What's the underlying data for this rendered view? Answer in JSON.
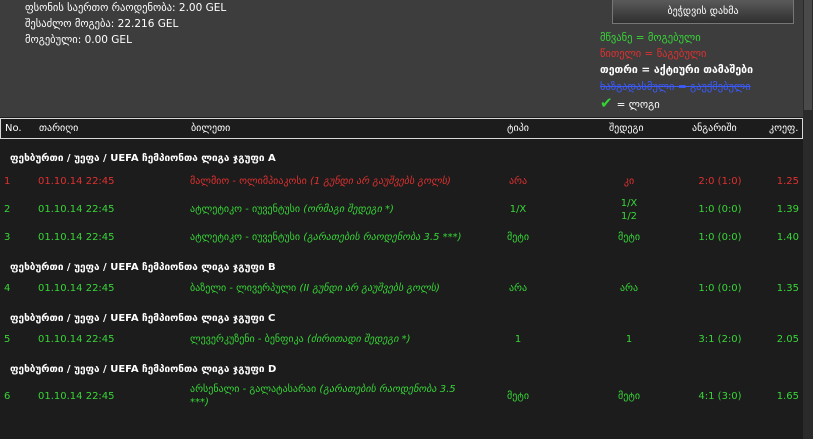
{
  "summary": {
    "total_stake": "ფსონის საერთო რაოდენობა: 2.00 GEL",
    "potential_win": "შესაძლო მოგება: 22.216 GEL",
    "won": "მოგებული: 0.00 GEL"
  },
  "print_button": "ბეჭდვის დახმა",
  "legend": {
    "won": "მწვანე = მოგებული",
    "lost": "წითელი = წაგებული",
    "active": "თეთრი = აქტიური თამაშები",
    "unset": "ხაზგადასმული = გაუქმებული",
    "stake": "= ლოგი"
  },
  "columns": {
    "no": "No.",
    "date": "თარიღი",
    "event": "ბილეთი",
    "type": "ტიპი",
    "prediction": "შედეგი",
    "result": "ანგარიში",
    "odds": "კოეფ."
  },
  "groups": [
    {
      "title": "ფეხბურთი / უეფა / UEFA ჩემპიონთა ლიგა ჯგუფი A"
    },
    {
      "title": "ფეხბურთი / უეფა / UEFA ჩემპიონთა ლიგა ჯგუფი B"
    },
    {
      "title": "ფეხბურთი / უეფა / UEFA ჩემპიონთა ლიგა ჯგუფი C"
    },
    {
      "title": "ფეხბურთი / უეფა / UEFA ჩემპიონთა ლიგა ჯგუფი D"
    }
  ],
  "rows": [
    {
      "no": "1",
      "date": "01.10.14 22:45",
      "event": "მალმიო - ოლიმპიაკოსი",
      "note": "(1 გუნდი არ გაუშვებს გოლს)",
      "type": "არა",
      "prediction": "კი",
      "result": "2:0 (1:0)",
      "odds": "1.25",
      "status": "lost"
    },
    {
      "no": "2",
      "date": "01.10.14 22:45",
      "event": "ატლეტიკო - იუვენტუსი",
      "note": "(ორმაგი შედეგი *)",
      "type": "1/X",
      "prediction_line1": "1/X",
      "prediction_line2": "1/2",
      "result": "1:0 (0:0)",
      "odds": "1.39",
      "status": "won"
    },
    {
      "no": "3",
      "date": "01.10.14 22:45",
      "event": "ატლეტიკო - იუვენტუსი",
      "note": "(გარათების რაოდენობა 3.5 ***)",
      "type": "მეტი",
      "prediction": "მეტი",
      "result": "1:0 (0:0)",
      "odds": "1.40",
      "status": "won"
    },
    {
      "no": "4",
      "date": "01.10.14 22:45",
      "event": "ბაზელი - ლივერპული",
      "note": "(II გუნდი არ გაუშვებს გოლს)",
      "type": "არა",
      "prediction": "არა",
      "result": "1:0 (0:0)",
      "odds": "1.35",
      "status": "won"
    },
    {
      "no": "5",
      "date": "01.10.14 22:45",
      "event": "ლევერკუზენი - ბენფიკა",
      "note": "(ძირითადი შედეგი *)",
      "type": "1",
      "prediction": "1",
      "result": "3:1 (2:0)",
      "odds": "2.05",
      "status": "won"
    },
    {
      "no": "6",
      "date": "01.10.14 22:45",
      "event": "არსენალი - გალატასარაი",
      "note": "(გარათების რაოდენობა 3.5 ***)",
      "type": "მეტი",
      "prediction": "მეტი",
      "result": "4:1 (3:0)",
      "odds": "1.65",
      "status": "won"
    }
  ],
  "colors": {
    "won": "#37d637",
    "lost": "#e03030",
    "background": "#1e1e1e",
    "header_bg": "#3d3d3d"
  }
}
